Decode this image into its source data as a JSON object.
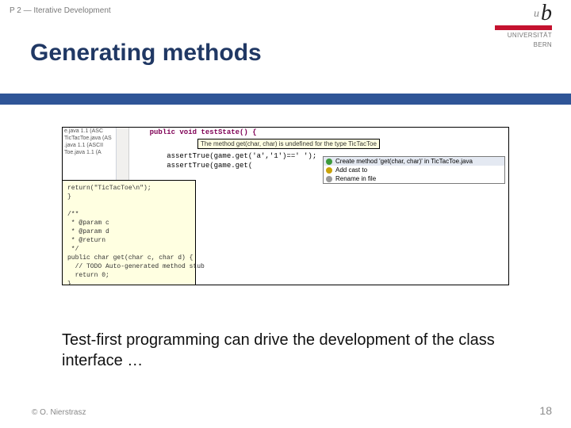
{
  "header": {
    "breadcrumb": "P 2 — Iterative Development",
    "title": "Generating methods"
  },
  "logo": {
    "uni_line1": "UNIVERSITÄT",
    "uni_line2": "BERN"
  },
  "ide": {
    "files": {
      "f0": "e.java 1.1 (ASC",
      "f1": "TicTacToe.java (AS",
      "f2": ".java 1.1 (ASCII",
      "f3": "Toe.java 1.1 (A"
    },
    "code": {
      "sig": "    public void testState() {",
      "a1": "        assertTrue(game.get('a','1')==' ');",
      "a2": "        assertTrue(game.get(     "
    },
    "error_msg": "The method get(char, char) is undefined for the type TicTacToe",
    "quickfix": {
      "q0": "Create method 'get(char, char)' in TicTacToe.java",
      "q1": "Add cast to ",
      "q2": "Rename in file"
    },
    "tooltip": "return(\"TicTacToe\\n\");\n}\n\n/**\n * @param c\n * @param d\n * @return\n */\npublic char get(char c, char d) {\n  // TODO Auto-generated method stub\n  return 0;\n}"
  },
  "body": {
    "text": "Test-first programming can drive the development of the class interface …"
  },
  "footer": {
    "copyright": "© O. Nierstrasz",
    "page": "18"
  }
}
